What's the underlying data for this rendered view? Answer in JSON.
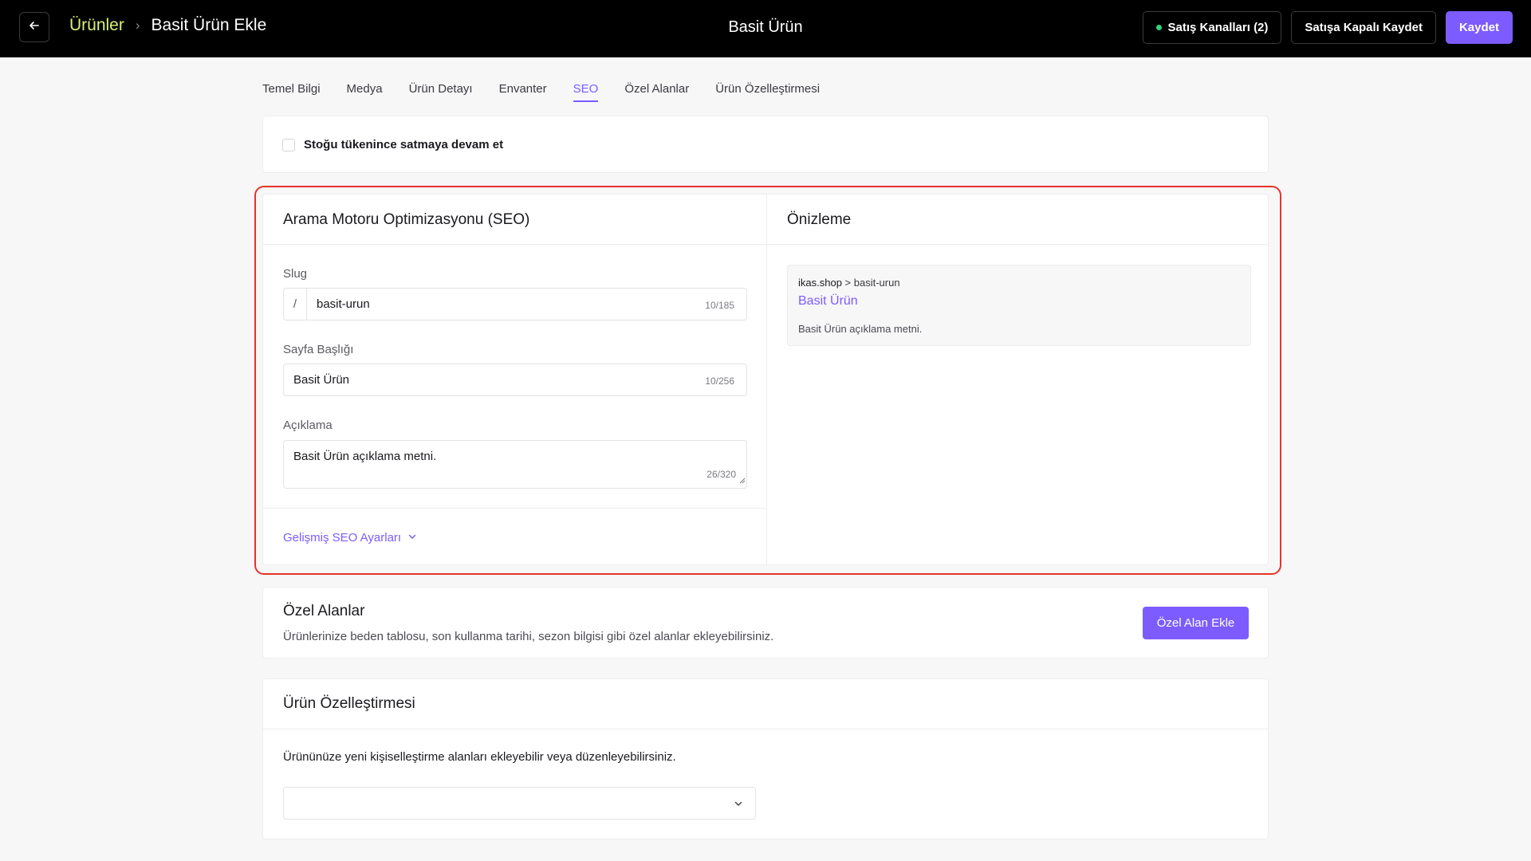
{
  "header": {
    "breadcrumb_parent": "Ürünler",
    "breadcrumb_separator": "›",
    "breadcrumb_current": "Basit Ürün Ekle",
    "title": "Basit Ürün",
    "sales_channels_label": "Satış Kanalları (2)",
    "save_closed_label": "Satışa Kapalı Kaydet",
    "save_label": "Kaydet"
  },
  "tabs": [
    {
      "label": "Temel Bilgi"
    },
    {
      "label": "Medya"
    },
    {
      "label": "Ürün Detayı"
    },
    {
      "label": "Envanter"
    },
    {
      "label": "SEO"
    },
    {
      "label": "Özel Alanlar"
    },
    {
      "label": "Ürün Özelleştirmesi"
    }
  ],
  "active_tab": "SEO",
  "inventory": {
    "continue_selling_label": "Stoğu tükenince satmaya devam et",
    "continue_selling_checked": false
  },
  "seo": {
    "title": "Arama Motoru Optimizasyonu (SEO)",
    "slug_label": "Slug",
    "slug_prefix": "/",
    "slug_value": "basit-urun",
    "slug_counter": "10/185",
    "page_title_label": "Sayfa Başlığı",
    "page_title_value": "Basit Ürün",
    "page_title_counter": "10/256",
    "description_label": "Açıklama",
    "description_value": "Basit Ürün açıklama metni.",
    "description_counter": "26/320",
    "advanced_label": "Gelişmiş SEO Ayarları"
  },
  "preview": {
    "title": "Önizleme",
    "domain": "ikas.shop",
    "path": " > basit-urun",
    "link_title": "Basit Ürün",
    "description": "Basit Ürün açıklama metni."
  },
  "custom_fields": {
    "title": "Özel Alanlar",
    "description": "Ürünlerinize beden tablosu, son kullanma tarihi, sezon bilgisi gibi özel alanlar ekleyebilirsiniz.",
    "add_button_label": "Özel Alan Ekle"
  },
  "customization": {
    "title": "Ürün Özelleştirmesi",
    "description": "Ürününüze yeni kişiselleştirme alanları ekleyebilir veya düzenleyebilirsiniz.",
    "select_value": ""
  },
  "colors": {
    "accent": "#7c5cff",
    "breadcrumb_link": "#d9f07a",
    "highlight_border": "#e5332a",
    "status_dot": "#2ed47a"
  }
}
